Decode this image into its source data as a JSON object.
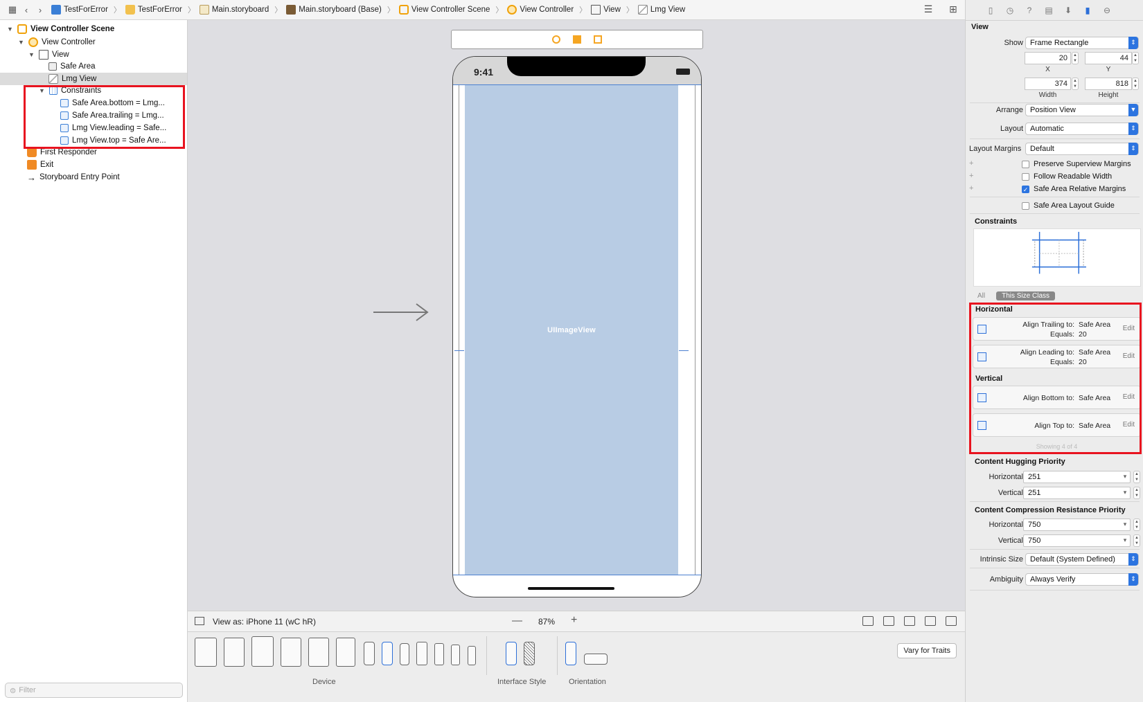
{
  "jumpbar": {
    "crumbs": [
      "TestForError",
      "TestForError",
      "Main.storyboard",
      "Main.storyboard (Base)",
      "View Controller Scene",
      "View Controller",
      "View",
      "Lmg View"
    ]
  },
  "outline": {
    "items": [
      {
        "label": "View Controller Scene"
      },
      {
        "label": "View Controller"
      },
      {
        "label": "View"
      },
      {
        "label": "Safe Area"
      },
      {
        "label": "Lmg View"
      },
      {
        "label": "Constraints"
      },
      {
        "label": "Safe Area.bottom = Lmg..."
      },
      {
        "label": "Safe Area.trailing = Lmg..."
      },
      {
        "label": "Lmg View.leading = Safe..."
      },
      {
        "label": "Lmg View.top = Safe Are..."
      },
      {
        "label": "First Responder"
      },
      {
        "label": "Exit"
      },
      {
        "label": "Storyboard Entry Point"
      }
    ],
    "filter_placeholder": "Filter"
  },
  "canvas": {
    "time": "9:41",
    "image_view_label": "UIImageView"
  },
  "canvas_bar": {
    "view_as": "View as: iPhone 11 (wC hR)",
    "zoom": "87%"
  },
  "device_bar": {
    "device_label": "Device",
    "interface_style_label": "Interface Style",
    "orientation_label": "Orientation",
    "vary_button": "Vary for Traits"
  },
  "inspector": {
    "view_title": "View",
    "show_label": "Show",
    "show_value": "Frame Rectangle",
    "x": "20",
    "y": "44",
    "width": "374",
    "height": "818",
    "x_label": "X",
    "y_label": "Y",
    "width_label": "Width",
    "height_label": "Height",
    "arrange_label": "Arrange",
    "arrange_value": "Position View",
    "layout_label": "Layout",
    "layout_value": "Automatic",
    "layout_margins_label": "Layout Margins",
    "layout_margins_value": "Default",
    "checks": [
      {
        "label": "Preserve Superview Margins",
        "checked": false
      },
      {
        "label": "Follow Readable Width",
        "checked": false
      },
      {
        "label": "Safe Area Relative Margins",
        "checked": true
      },
      {
        "label": "Safe Area Layout Guide",
        "checked": false
      }
    ],
    "constraints_title": "Constraints",
    "size_class_all": "All",
    "size_class_this": "This Size Class",
    "horizontal_title": "Horizontal",
    "vertical_title": "Vertical",
    "constraints": [
      {
        "line1_key": "Align Trailing to:",
        "line1_val": "Safe Area",
        "line2_key": "Equals:",
        "line2_val": "20",
        "edit": "Edit"
      },
      {
        "line1_key": "Align Leading to:",
        "line1_val": "Safe Area",
        "line2_key": "Equals:",
        "line2_val": "20",
        "edit": "Edit"
      },
      {
        "line1_key": "Align Bottom to:",
        "line1_val": "Safe Area",
        "edit": "Edit"
      },
      {
        "line1_key": "Align Top to:",
        "line1_val": "Safe Area",
        "edit": "Edit"
      }
    ],
    "showing": "Showing 4 of 4",
    "hugging_title": "Content Hugging Priority",
    "hugging_h_label": "Horizontal",
    "hugging_h": "251",
    "hugging_v_label": "Vertical",
    "hugging_v": "251",
    "compression_title": "Content Compression Resistance Priority",
    "compression_h_label": "Horizontal",
    "compression_h": "750",
    "compression_v_label": "Vertical",
    "compression_v": "750",
    "intrinsic_label": "Intrinsic Size",
    "intrinsic_value": "Default (System Defined)",
    "ambiguity_label": "Ambiguity",
    "ambiguity_value": "Always Verify"
  },
  "colors": {
    "highlight": "#e8131f",
    "accent": "#2c74e0",
    "image_view": "#b8cce4"
  }
}
